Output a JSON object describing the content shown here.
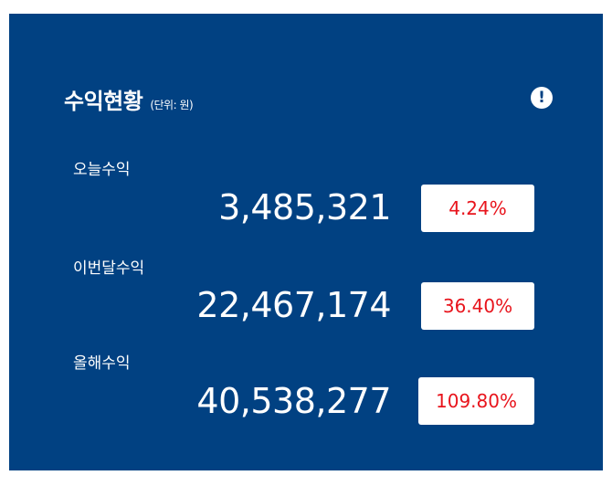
{
  "widget": {
    "title": "수익현황",
    "unit": "(단위: 원)",
    "info_icon": "exclamation-icon",
    "info_glyph": "!"
  },
  "rows": [
    {
      "label": "오늘수익",
      "value": "3,485,321",
      "change": "4.24%"
    },
    {
      "label": "이번달수익",
      "value": "22,467,174",
      "change": "36.40%"
    },
    {
      "label": "올해수익",
      "value": "40,538,277",
      "change": "109.80%"
    }
  ],
  "colors": {
    "panel_background": "#014182",
    "text": "#ffffff",
    "change_text": "#e8141c",
    "badge_background": "#ffffff"
  }
}
